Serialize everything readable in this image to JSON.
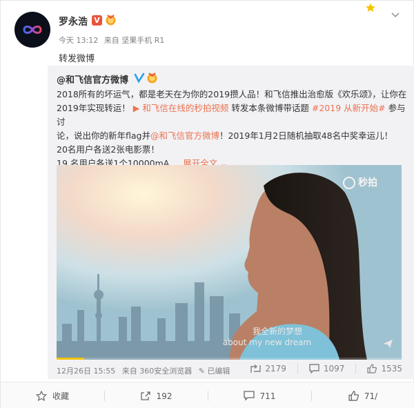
{
  "post": {
    "username": "罗永浩",
    "verified_badge": "V",
    "time": "今天 13:12",
    "source": "来自 坚果手机 R1",
    "text": "转发微博"
  },
  "repost": {
    "author": "@和飞信官方微博",
    "lines": [
      "2018所有的坏运气，都是老天在为你的2019攒人品！和飞信推出治愈版《欢乐颂》，让你在",
      "2019年实现转运！",
      "论，说出你的新年flag并",
      "！2019年1月2日随机抽取48名中奖幸运儿！",
      "20名用户各送2张电影票！",
      "19 名用户各送1个10000mA ..."
    ],
    "video_link": "和飞信在线的秒拍视频",
    "mid_text": " 转发本条微博带话题 ",
    "hashtag": "#2019 从新开始#",
    "after_tag": " 参与讨",
    "mention": "@和飞信官方微博",
    "expand": "展开全文",
    "video": {
      "watermark": "秒拍",
      "subtitle_cn": "我全新的梦想",
      "subtitle_en": "about my new dream",
      "progress": 0.08
    },
    "date": "12月26日 15:55",
    "source": "来自 360安全浏览器",
    "edited": "已编辑",
    "reposts": "2179",
    "comments": "1097",
    "likes": "1535"
  },
  "bottom_bar": {
    "favorite": "收藏",
    "reposts": "192",
    "comments": "711",
    "likes": "71/"
  },
  "colors": {
    "accent": "#eb7350",
    "verified": "#e7543a",
    "verified_blue": "#2b9fe8",
    "progress": "#f5c200"
  }
}
